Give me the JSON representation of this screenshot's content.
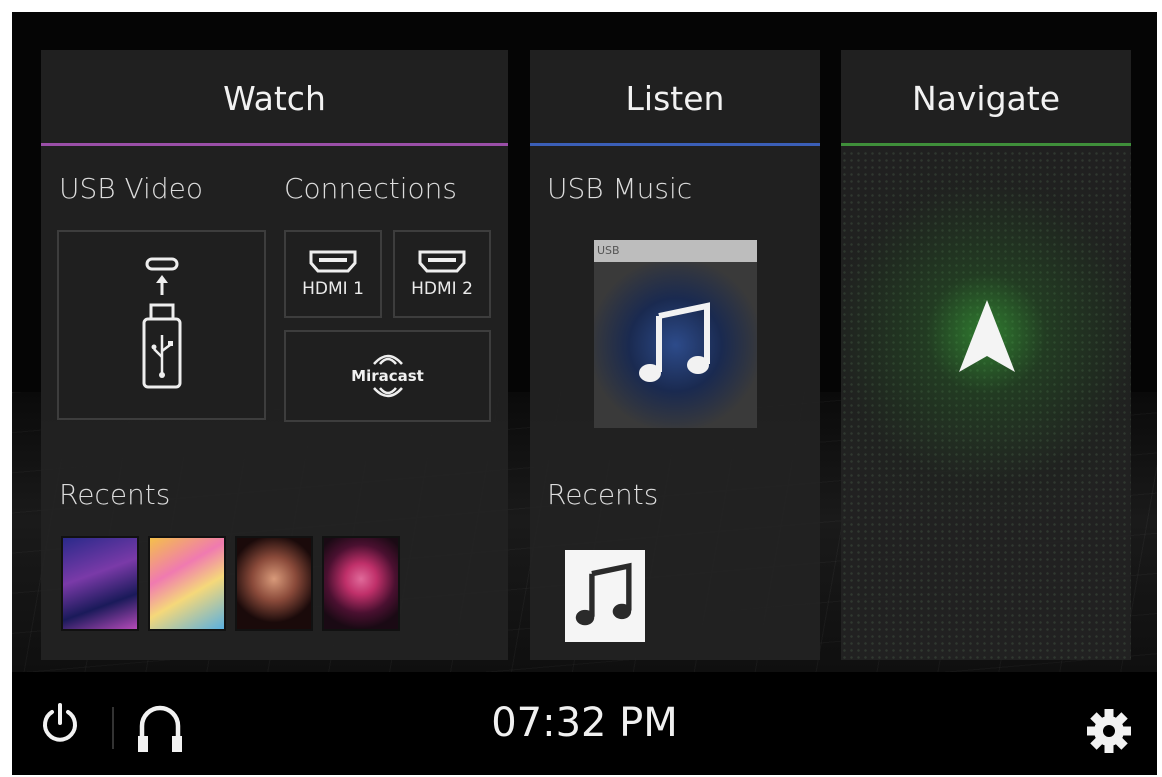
{
  "panels": {
    "watch": {
      "title": "Watch",
      "accent": "#9b4fa8",
      "usb_video_label": "USB Video",
      "connections_label": "Connections",
      "hdmi1_label": "HDMI 1",
      "hdmi2_label": "HDMI 2",
      "miracast_label": "Miracast",
      "recents_label": "Recents",
      "recent_thumbs": [
        "video-thumbnail-1",
        "video-thumbnail-2",
        "video-thumbnail-3",
        "video-thumbnail-4"
      ]
    },
    "listen": {
      "title": "Listen",
      "accent": "#3b5fb8",
      "usb_music_label": "USB Music",
      "usb_tag": "USB",
      "recents_label": "Recents"
    },
    "navigate": {
      "title": "Navigate",
      "accent": "#3f8f3a"
    }
  },
  "bottom_bar": {
    "clock": "07:32 PM",
    "icons": [
      "power-icon",
      "headphones-icon",
      "gear-icon"
    ]
  }
}
